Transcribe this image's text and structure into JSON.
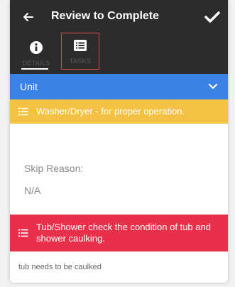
{
  "header": {
    "title": "Review to Complete",
    "back_icon": "arrow-left-icon",
    "confirm_icon": "checkmark-icon"
  },
  "tabs": [
    {
      "label": "DETAILS",
      "icon": "info-circle-icon",
      "active": true
    },
    {
      "label": "TASKS",
      "icon": "list-icon",
      "active": false
    }
  ],
  "unit_bar": {
    "label": "Unit",
    "icon": "chevron-down-icon",
    "color": "#3b82e6"
  },
  "tasks": [
    {
      "text": "Washer/Dryer -  for proper operation.",
      "color": "#f3c244",
      "skip_label": "Skip Reason:",
      "skip_value": "N/A"
    },
    {
      "text": "Tub/Shower check the condition of tub and shower caulking.",
      "color": "#e8304a",
      "note": "tub needs to be caulked"
    }
  ]
}
